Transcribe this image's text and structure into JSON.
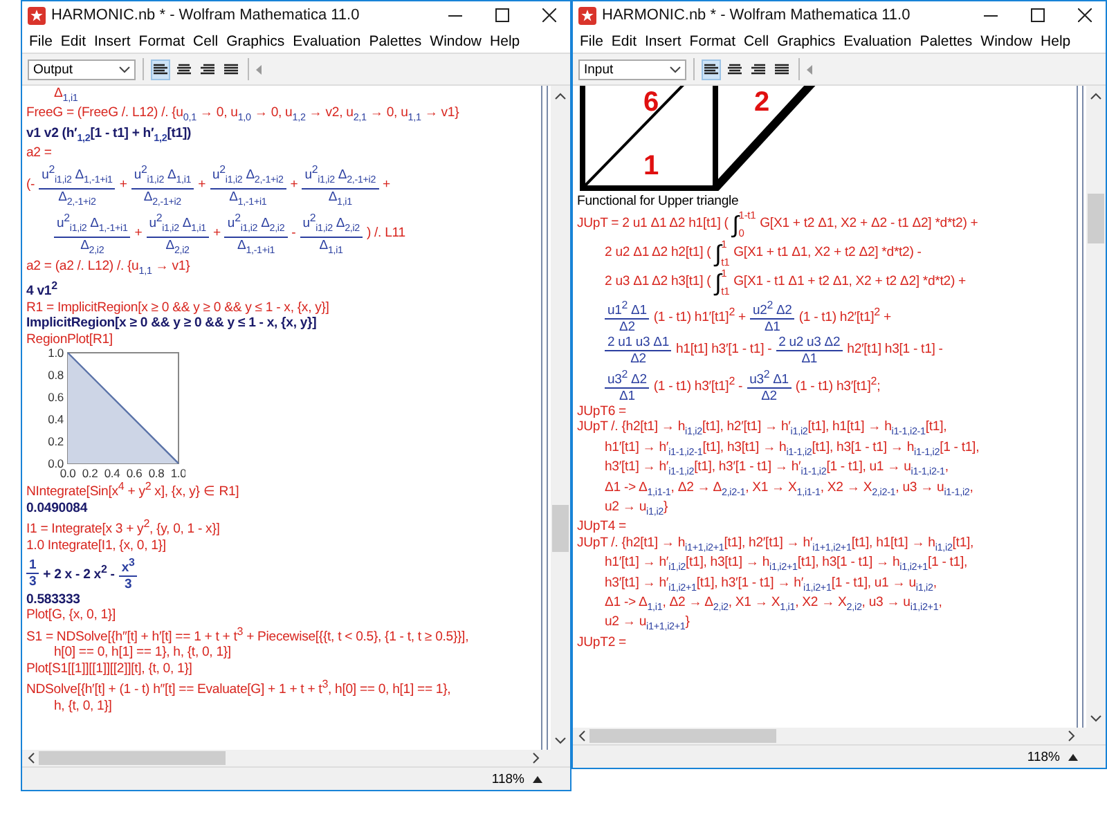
{
  "windows": [
    {
      "title": "HARMONIC.nb * - Wolfram Mathematica 11.0",
      "menu": [
        "File",
        "Edit",
        "Insert",
        "Format",
        "Cell",
        "Graphics",
        "Evaluation",
        "Palettes",
        "Window",
        "Help"
      ],
      "style_value": "Output",
      "alignment": [
        {
          "selected": true
        },
        {
          "selected": false
        },
        {
          "selected": false
        },
        {
          "selected": false
        }
      ],
      "zoom": "118%",
      "cells": [
        {
          "kind": "input",
          "indent": true,
          "text": "Δ$_{1,i1}$"
        },
        {
          "kind": "input",
          "text": "FreeG = (FreeG /. L12) /. {u$_{0,1}$ → 0, u$_{1,0}$ → 0, u$_{1,2}$ → v2, u$_{2,1}$ → 0, u$_{1,1}$ → v1}"
        },
        {
          "kind": "output",
          "text": "v1 v2 (h′$_{1,2}$[1 - t1] + h′$_{1,2}$[t1])"
        },
        {
          "kind": "input",
          "text": "a2 ="
        },
        {
          "kind": "input",
          "parts": [
            {
              "kind": "text",
              "text": "(-"
            },
            {
              "kind": "fraction",
              "num": "u$^{2}$$_{i1,i2}$ Δ$_{1,-1+i1}$",
              "den": "Δ$_{2,-1+i2}$"
            },
            {
              "kind": "text",
              "text": "+"
            },
            {
              "kind": "fraction",
              "num": "u$^{2}$$_{i1,i2}$ Δ$_{1,i1}$",
              "den": "Δ$_{2,-1+i2}$"
            },
            {
              "kind": "text",
              "text": "+"
            },
            {
              "kind": "fraction",
              "num": "u$^{2}$$_{i1,i2}$ Δ$_{2,-1+i2}$",
              "den": "Δ$_{1,-1+i1}$"
            },
            {
              "kind": "text",
              "text": "+"
            },
            {
              "kind": "fraction",
              "num": "u$^{2}$$_{i1,i2}$ Δ$_{2,-1+i2}$",
              "den": "Δ$_{1,i1}$"
            },
            {
              "kind": "text",
              "text": "+"
            }
          ]
        },
        {
          "kind": "input",
          "indent": true,
          "parts": [
            {
              "kind": "fraction",
              "num": "u$^{2}$$_{i1,i2}$ Δ$_{1,-1+i1}$",
              "den": "Δ$_{2,i2}$"
            },
            {
              "kind": "text",
              "text": "+"
            },
            {
              "kind": "fraction",
              "num": "u$^{2}$$_{i1,i2}$ Δ$_{1,i1}$",
              "den": "Δ$_{2,i2}$"
            },
            {
              "kind": "text",
              "text": "+"
            },
            {
              "kind": "fraction",
              "num": "u$^{2}$$_{i1,i2}$ Δ$_{2,i2}$",
              "den": "Δ$_{1,-1+i1}$"
            },
            {
              "kind": "text",
              "text": "-"
            },
            {
              "kind": "fraction",
              "num": "u$^{2}$$_{i1,i2}$ Δ$_{2,i2}$",
              "den": "Δ$_{1,i1}$"
            },
            {
              "kind": "text",
              "text": ") /. L11"
            }
          ]
        },
        {
          "kind": "input",
          "text": "a2 = (a2 /. L12) /. {u$_{1,1}$ → v1}"
        },
        {
          "kind": "output",
          "text": "4 v1$^{2}$"
        },
        {
          "kind": "input",
          "text": "R1 = ImplicitRegion[x ≥ 0 && y ≥ 0 && y ≤ 1 - x, {x, y}]"
        },
        {
          "kind": "output",
          "text": "ImplicitRegion[x ≥ 0 && y ≥ 0 && y ≤ 1 - x, {x, y}]"
        },
        {
          "kind": "input",
          "text": "RegionPlot[R1]"
        },
        {
          "kind": "plot",
          "chart_data": {
            "type": "area",
            "x": [
              0,
              1
            ],
            "values": [
              1,
              0
            ],
            "xlim": [
              0,
              1
            ],
            "ylim": [
              0,
              1
            ],
            "xticks": [
              {
                "value": 0,
                "label": "0.0"
              },
              {
                "value": 0.2,
                "label": "0.2"
              },
              {
                "value": 0.4,
                "label": "0.4"
              },
              {
                "value": 0.6,
                "label": "0.6"
              },
              {
                "value": 0.8,
                "label": "0.8"
              },
              {
                "value": 1,
                "label": "1.0"
              }
            ],
            "yticks": [
              {
                "value": 0,
                "label": "0.0"
              },
              {
                "value": 0.2,
                "label": "0.2"
              },
              {
                "value": 0.4,
                "label": "0.4"
              },
              {
                "value": 0.6,
                "label": "0.6"
              },
              {
                "value": 0.8,
                "label": "0.8"
              },
              {
                "value": 1,
                "label": "1.0"
              }
            ]
          }
        },
        {
          "kind": "input",
          "text": "NIntegrate[Sin[x$^{4}$ + y$^{2}$ x], {x, y} ∈ R1]"
        },
        {
          "kind": "output",
          "text": "0.0490084"
        },
        {
          "kind": "input",
          "text": "I1 = Integrate[x 3 + y$^{2}$, {y, 0, 1 - x}]"
        },
        {
          "kind": "input",
          "text": "1.0 Integrate[I1, {x, 0, 1}]"
        },
        {
          "kind": "output",
          "parts": [
            {
              "kind": "fraction",
              "num": "1",
              "den": "3"
            },
            {
              "kind": "text",
              "text": "+ 2 x - 2 x$^{2}$ -"
            },
            {
              "kind": "fraction",
              "num": "x$^{3}$",
              "den": "3"
            }
          ]
        },
        {
          "kind": "output",
          "text": "0.583333"
        },
        {
          "kind": "input",
          "text": "Plot[G, {x, 0, 1}]"
        },
        {
          "kind": "input",
          "text": "S1 = NDSolve[{h″[t] + h′[t] == 1 + t + t$^{3}$ + Piecewise[{{t, t < 0.5}, {1 - t, t ≥ 0.5}}],"
        },
        {
          "kind": "input",
          "indent": true,
          "text": "h[0] == 0, h[1] == 1}, h, {t, 0, 1}]"
        },
        {
          "kind": "input",
          "text": "Plot[S1[[1]][[1]][[2]][t], {t, 0, 1}]"
        },
        {
          "kind": "input",
          "text": "NDSolve[{h′[t] + (1 - t) h″[t] == Evaluate[G] + 1 + t + t$^{3}$, h[0] == 0, h[1] == 1},"
        },
        {
          "kind": "input",
          "indent": true,
          "text": "h, {t, 0, 1}]"
        }
      ]
    },
    {
      "title": "HARMONIC.nb * - Wolfram Mathematica 11.0",
      "menu": [
        "File",
        "Edit",
        "Insert",
        "Format",
        "Cell",
        "Graphics",
        "Evaluation",
        "Palettes",
        "Window",
        "Help"
      ],
      "style_value": "Input",
      "alignment": [
        {
          "selected": true
        },
        {
          "selected": false
        },
        {
          "selected": false
        },
        {
          "selected": false
        }
      ],
      "zoom": "118%",
      "cells": [
        {
          "kind": "drawing",
          "labels": [
            "6",
            "2",
            "1"
          ]
        },
        {
          "kind": "text",
          "text": "Functional for Upper triangle"
        },
        {
          "kind": "input",
          "parts": [
            {
              "kind": "text",
              "text": "JUpT = 2 u1 Δ1 Δ2 h1[t1] ("
            },
            {
              "kind": "integral",
              "sign": "∫",
              "lower": "0",
              "upper": "1-t1"
            },
            {
              "kind": "text",
              "text": "G[X1 + t2 Δ1, X2 + Δ2 - t1 Δ2] *d*t2) +"
            }
          ]
        },
        {
          "kind": "input",
          "indent": true,
          "parts": [
            {
              "kind": "text",
              "text": "2 u2 Δ1 Δ2 h2[t1] ("
            },
            {
              "kind": "integral",
              "sign": "∫",
              "lower": "t1",
              "upper": "1"
            },
            {
              "kind": "text",
              "text": "G[X1 + t1 Δ1, X2 + t2 Δ2] *d*t2) -"
            }
          ]
        },
        {
          "kind": "input",
          "indent": true,
          "parts": [
            {
              "kind": "text",
              "text": "2 u3 Δ1 Δ2 h3[t1] ("
            },
            {
              "kind": "integral",
              "sign": "∫",
              "lower": "t1",
              "upper": "1"
            },
            {
              "kind": "text",
              "text": "G[X1 - t1 Δ1 + t2 Δ1, X2 + t2 Δ2] *d*t2) +"
            }
          ]
        },
        {
          "kind": "input",
          "indent": true,
          "parts": [
            {
              "kind": "fraction",
              "num": "u1$^{2}$ Δ1",
              "den": "Δ2"
            },
            {
              "kind": "text",
              "text": "(1 - t1) h1′[t1]$^{2}$ +"
            },
            {
              "kind": "fraction",
              "num": "u2$^{2}$ Δ2",
              "den": "Δ1"
            },
            {
              "kind": "text",
              "text": "(1 - t1) h2′[t1]$^{2}$ +"
            }
          ]
        },
        {
          "kind": "input",
          "indent": true,
          "parts": [
            {
              "kind": "fraction",
              "num": "2 u1 u3 Δ1",
              "den": "Δ2"
            },
            {
              "kind": "text",
              "text": "h1[t1] h3′[1 - t1] -"
            },
            {
              "kind": "fraction",
              "num": "2 u2 u3 Δ2",
              "den": "Δ1"
            },
            {
              "kind": "text",
              "text": "h2′[t1] h3[1 - t1] -"
            }
          ]
        },
        {
          "kind": "input",
          "indent": true,
          "parts": [
            {
              "kind": "fraction",
              "num": "u3$^{2}$ Δ2",
              "den": "Δ1"
            },
            {
              "kind": "text",
              "text": "(1 - t1) h3′[t1]$^{2}$ -"
            },
            {
              "kind": "fraction",
              "num": "u3$^{2}$ Δ1",
              "den": "Δ2"
            },
            {
              "kind": "text",
              "text": "(1 - t1) h3′[t1]$^{2}$;"
            }
          ]
        },
        {
          "kind": "input",
          "text": "JUpT6 ="
        },
        {
          "kind": "input",
          "text": "  JUpT /. {h2[t1] → h$_{i1,i2}$[t1], h2′[t1] → h′$_{i1,i2}$[t1], h1[t1] → h$_{i1-1,i2-1}$[t1],"
        },
        {
          "kind": "input",
          "indent": true,
          "text": "h1′[t1] → h′$_{i1-1,i2-1}$[t1], h3[t1] → h$_{i1-1,i2}$[t1], h3[1 - t1] → h$_{i1-1,i2}$[1 - t1],"
        },
        {
          "kind": "input",
          "indent": true,
          "text": "h3′[t1] → h′$_{i1-1,i2}$[t1], h3′[1 - t1] → h′$_{i1-1,i2}$[1 - t1], u1 → u$_{i1-1,i2-1}$,"
        },
        {
          "kind": "input",
          "indent": true,
          "text": "Δ1 -> Δ$_{1,i1-1}$, Δ2 → Δ$_{2,i2-1}$, X1 → X$_{1,i1-1}$, X2 → X$_{2,i2-1}$, u3 → u$_{i1-1,i2}$,"
        },
        {
          "kind": "input",
          "indent": true,
          "text": "u2 → u$_{i1,i2}$}"
        },
        {
          "kind": "input",
          "text": "JUpT4 ="
        },
        {
          "kind": "input",
          "text": "  JUpT /. {h2[t1] → h$_{i1+1,i2+1}$[t1], h2′[t1] → h′$_{i1+1,i2+1}$[t1], h1[t1] → h$_{i1,i2}$[t1],"
        },
        {
          "kind": "input",
          "indent": true,
          "text": "h1′[t1] → h′$_{i1,i2}$[t1], h3[t1] → h$_{i1,i2+1}$[t1], h3[1 - t1] → h$_{i1,i2+1}$[1 - t1],"
        },
        {
          "kind": "input",
          "indent": true,
          "text": "h3′[t1] → h′$_{i1,i2+1}$[t1], h3′[1 - t1] → h′$_{i1,i2+1}$[1 - t1], u1 → u$_{i1,i2}$,"
        },
        {
          "kind": "input",
          "indent": true,
          "text": "Δ1 -> Δ$_{1,i1}$, Δ2 → Δ$_{2,i2}$, X1 → X$_{1,i1}$, X2 → X$_{2,i2}$, u3 → u$_{i1,i2+1}$,"
        },
        {
          "kind": "input",
          "indent": true,
          "text": "u2 → u$_{i1+1,i2+1}$}"
        },
        {
          "kind": "input",
          "text": "JUpT2 ="
        }
      ]
    }
  ]
}
